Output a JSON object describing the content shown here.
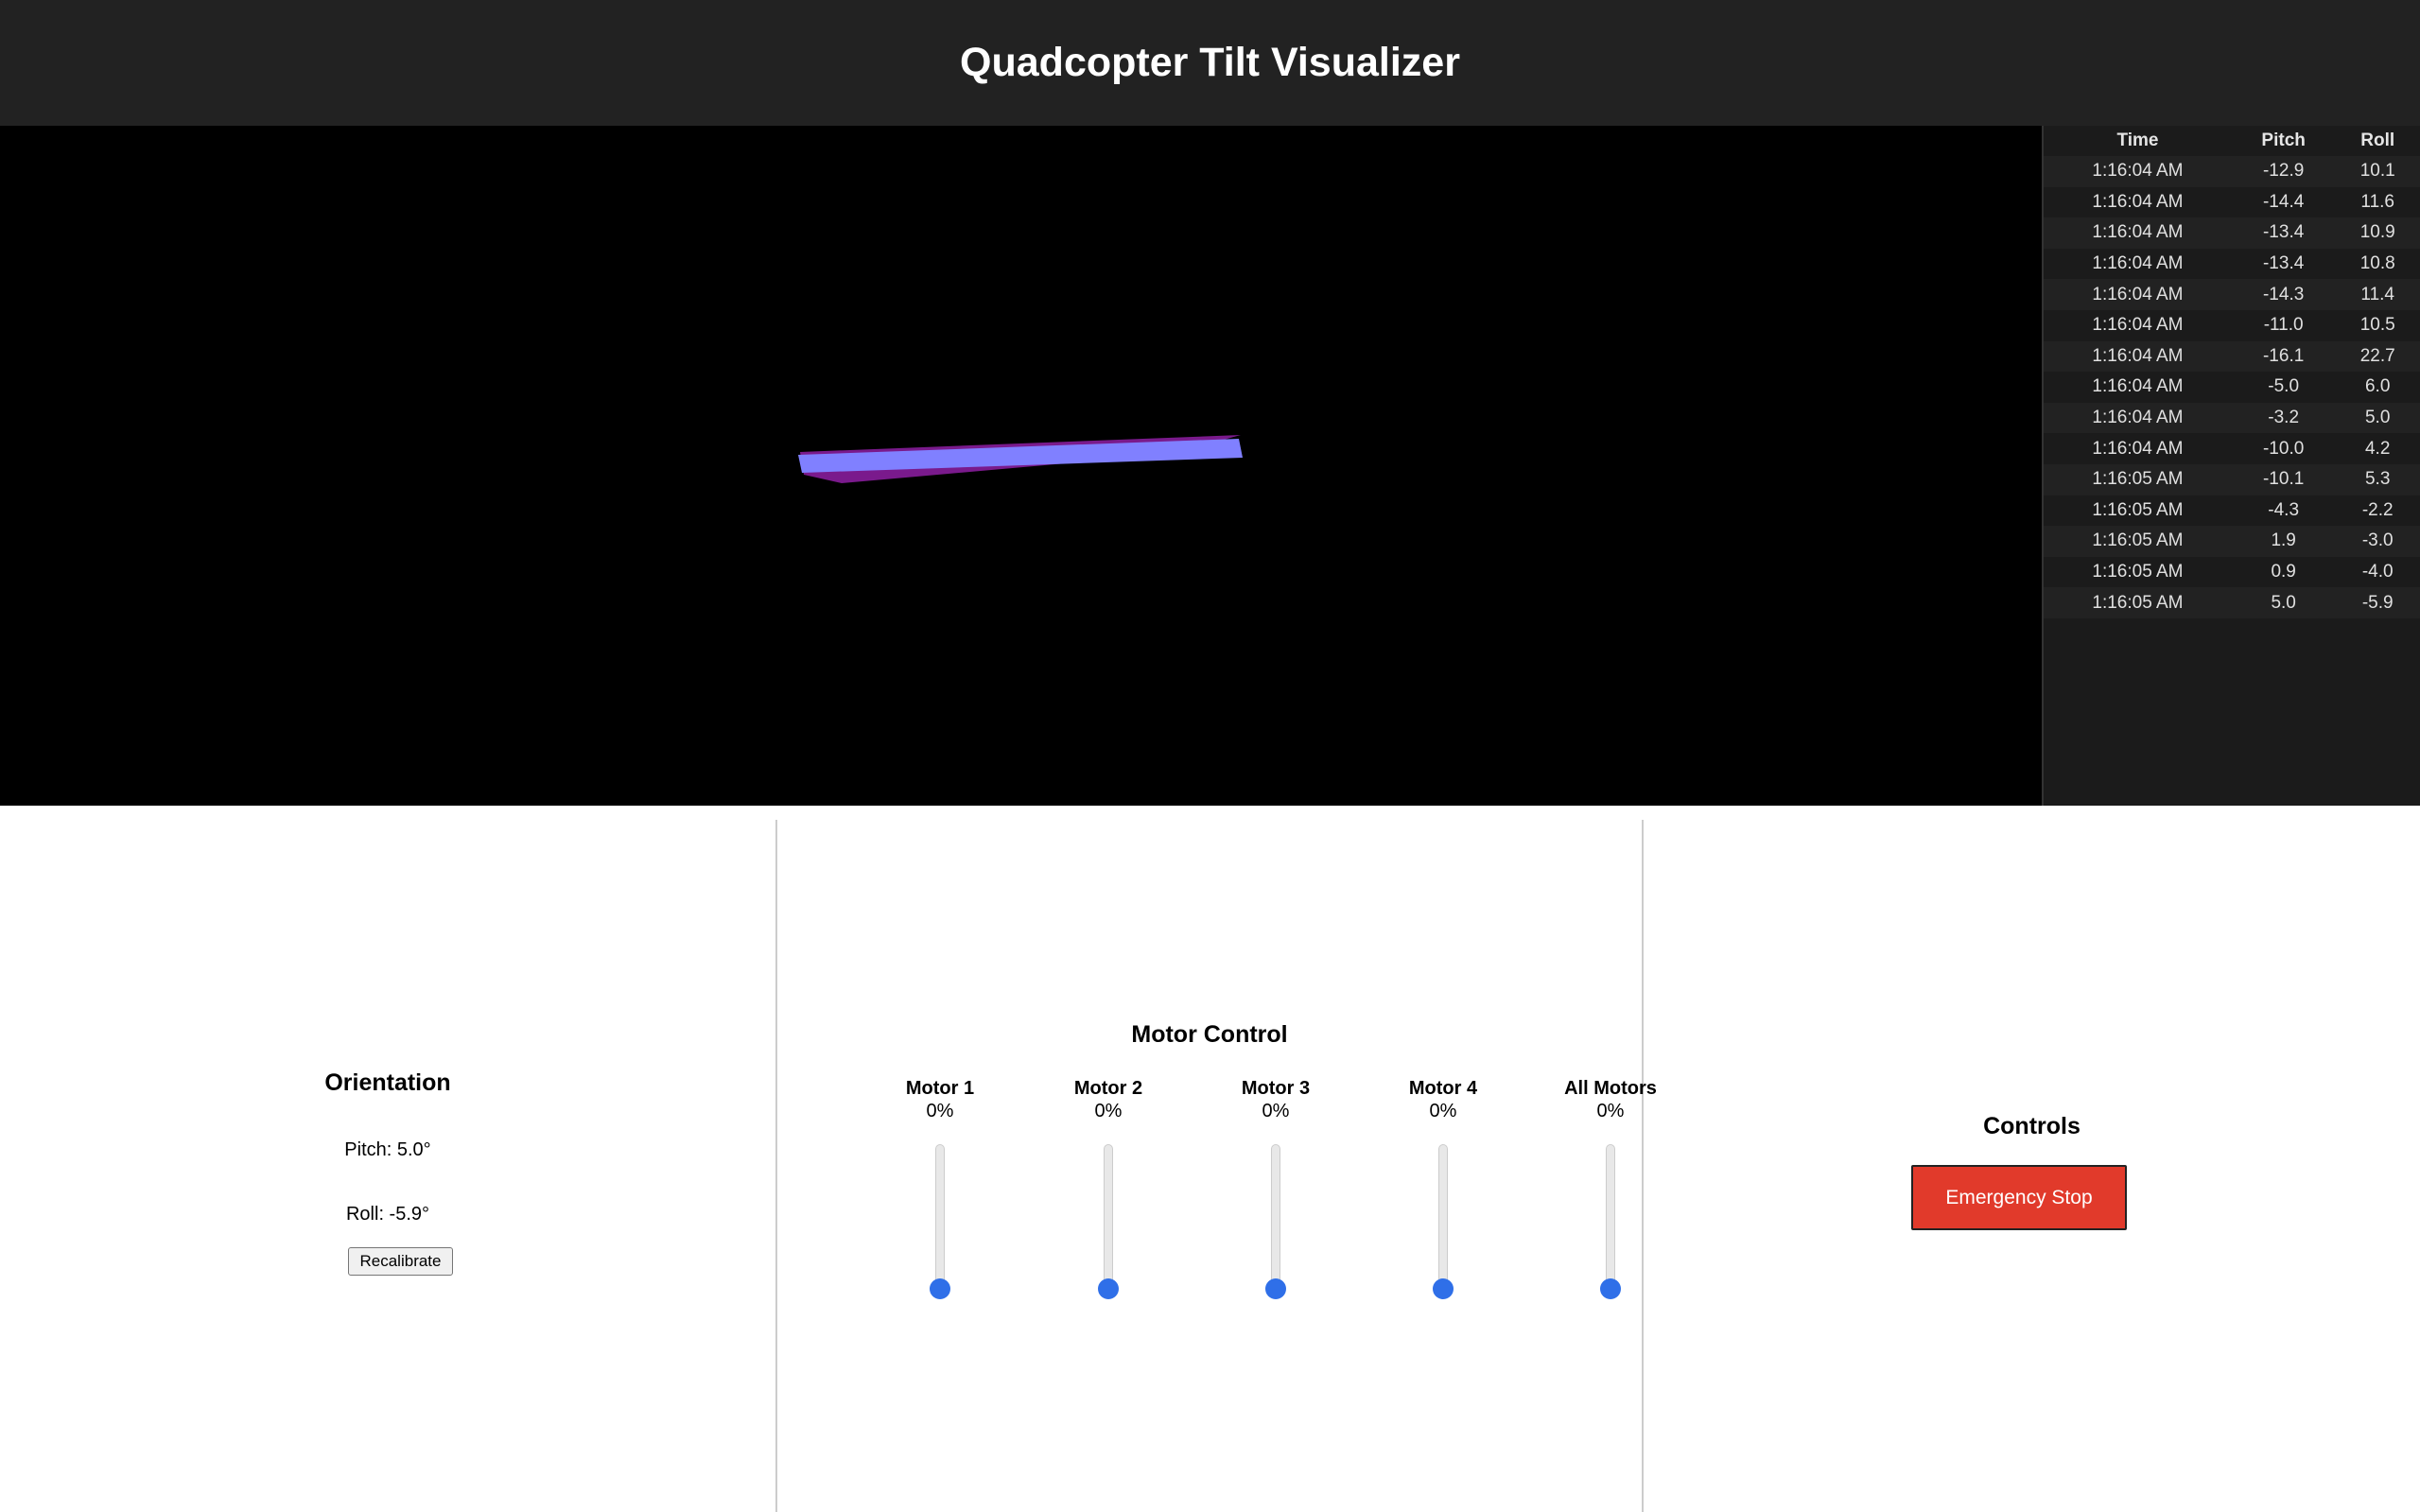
{
  "header": {
    "title": "Quadcopter Tilt Visualizer"
  },
  "viewport": {
    "top_face_color": "#8080ff",
    "side_face_color": "#7a1a8c",
    "background_color": "#000000"
  },
  "log": {
    "columns": [
      "Time",
      "Pitch",
      "Roll"
    ],
    "rows": [
      [
        "1:16:04 AM",
        "-12.9",
        "10.1"
      ],
      [
        "1:16:04 AM",
        "-14.4",
        "11.6"
      ],
      [
        "1:16:04 AM",
        "-13.4",
        "10.9"
      ],
      [
        "1:16:04 AM",
        "-13.4",
        "10.8"
      ],
      [
        "1:16:04 AM",
        "-14.3",
        "11.4"
      ],
      [
        "1:16:04 AM",
        "-11.0",
        "10.5"
      ],
      [
        "1:16:04 AM",
        "-16.1",
        "22.7"
      ],
      [
        "1:16:04 AM",
        "-5.0",
        "6.0"
      ],
      [
        "1:16:04 AM",
        "-3.2",
        "5.0"
      ],
      [
        "1:16:04 AM",
        "-10.0",
        "4.2"
      ],
      [
        "1:16:05 AM",
        "-10.1",
        "5.3"
      ],
      [
        "1:16:05 AM",
        "-4.3",
        "-2.2"
      ],
      [
        "1:16:05 AM",
        "1.9",
        "-3.0"
      ],
      [
        "1:16:05 AM",
        "0.9",
        "-4.0"
      ],
      [
        "1:16:05 AM",
        "5.0",
        "-5.9"
      ]
    ]
  },
  "orientation": {
    "title": "Orientation",
    "pitch_text": "Pitch: 5.0°",
    "roll_text": "Roll: -5.9°",
    "recalibrate_label": "Recalibrate"
  },
  "motor_control": {
    "title": "Motor Control",
    "motors": [
      {
        "label": "Motor 1",
        "value": "0%",
        "level": 0
      },
      {
        "label": "Motor 2",
        "value": "0%",
        "level": 0
      },
      {
        "label": "Motor 3",
        "value": "0%",
        "level": 0
      },
      {
        "label": "Motor 4",
        "value": "0%",
        "level": 0
      },
      {
        "label": "All Motors",
        "value": "0%",
        "level": 0
      }
    ],
    "slider_color": "#2f6fe8"
  },
  "controls": {
    "title": "Controls",
    "emergency_stop_label": "Emergency Stop",
    "emergency_color": "#e13a2b"
  }
}
